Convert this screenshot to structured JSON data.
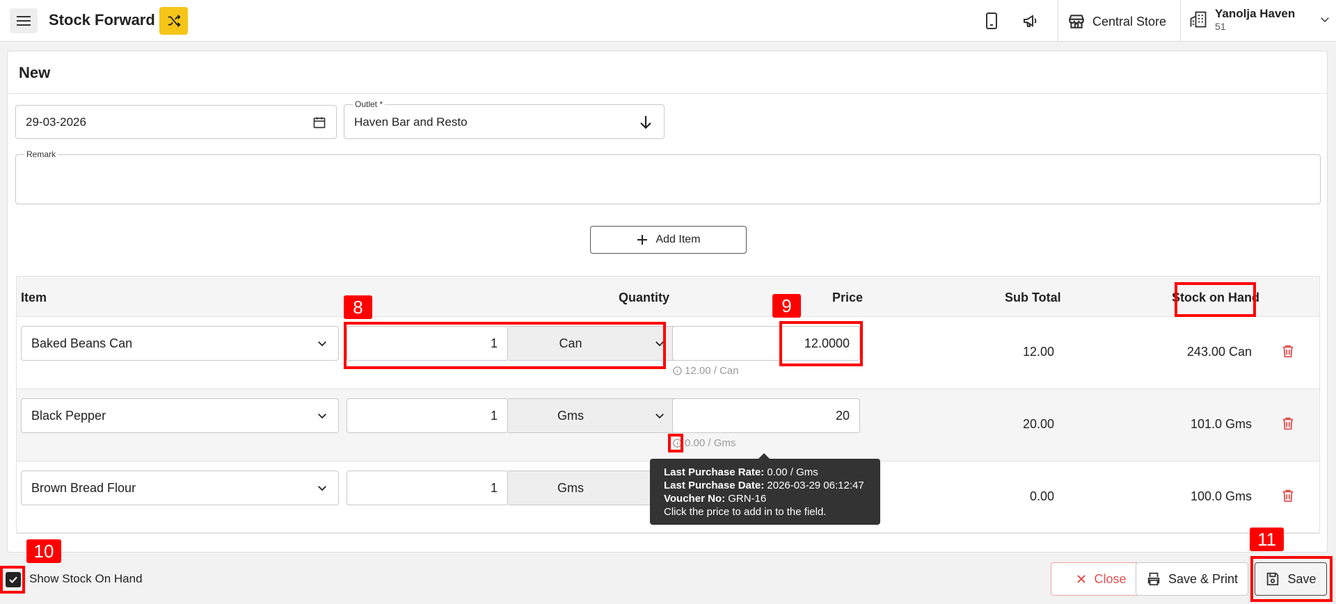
{
  "header": {
    "app_title": "Stock Forward",
    "store_name": "Central Store",
    "company_name": "Yanolja Haven",
    "company_sub": "51"
  },
  "form": {
    "title": "New",
    "date_value": "29-03-2026",
    "outlet_label": "Outlet *",
    "outlet_value": "Haven Bar and Resto",
    "remark_label": "Remark",
    "remark_value": "",
    "add_item_label": "Add Item"
  },
  "table": {
    "columns": {
      "item": "Item",
      "quantity": "Quantity",
      "price": "Price",
      "subtotal": "Sub Total",
      "stock": "Stock on Hand"
    },
    "rows": [
      {
        "item": "Baked Beans Can",
        "qty": "1",
        "unit": "Can",
        "price": "12.0000",
        "price_hint": "12.00 / Can",
        "subtotal": "12.00",
        "stock": "243.00 Can"
      },
      {
        "item": "Black Pepper",
        "qty": "1",
        "unit": "Gms",
        "price": "20",
        "price_hint": "0.00 / Gms",
        "subtotal": "20.00",
        "stock": "101.0 Gms"
      },
      {
        "item": "Brown Bread Flour",
        "qty": "1",
        "unit": "Gms",
        "price": "",
        "price_hint": "",
        "subtotal": "0.00",
        "stock": "100.0 Gms"
      }
    ]
  },
  "tooltip": {
    "rate_label": "Last Purchase Rate:",
    "rate_value": "0.00 / Gms",
    "date_label": "Last Purchase Date:",
    "date_value": "2026-03-29 06:12:47",
    "voucher_label": "Voucher No:",
    "voucher_value": "GRN-16",
    "hint": "Click the price to add in to the field."
  },
  "footer": {
    "show_stock_label": "Show Stock On Hand",
    "show_stock_checked": true,
    "close_label": "Close",
    "save_print_label": "Save & Print",
    "save_label": "Save"
  },
  "annotations": [
    "8",
    "9",
    "10",
    "11"
  ],
  "colors": {
    "accent": "#f5c518",
    "annotation": "#ff0000",
    "danger": "#e05050"
  }
}
